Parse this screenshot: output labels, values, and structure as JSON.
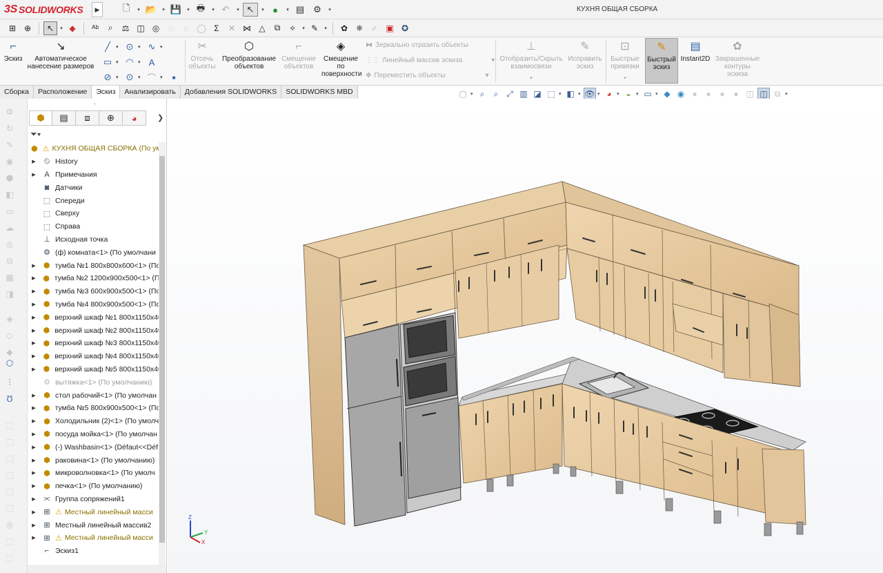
{
  "app": {
    "logo_text": "SOLIDWORKS",
    "logo_prefix": "3S",
    "document_title": "КУХНЯ ОБЩАЯ СБОРКА"
  },
  "quick_access": [
    "new-icon",
    "open-icon",
    "save-icon",
    "print-icon",
    "undo-icon",
    "select-icon",
    "rebuild-icon",
    "file-properties-icon",
    "options-icon"
  ],
  "ribbon": {
    "sketch": "Эскиз",
    "smart_dimension": "Автоматическое нанесение размеров",
    "trim": "Отсечь объекты",
    "convert": "Преобразование объектов",
    "offset": "Смещение объектов",
    "offset_surface": "Смещение по поверхности",
    "mirror": "Зеркально отразить объекты",
    "linear_pattern": "Линейный массив эскиза",
    "move": "Переместить объекты",
    "display_relations": "Отобразить/Скрыть взаимосвязи",
    "repair": "Исправить эскиз",
    "quick_snaps": "Быстрые привязки",
    "rapid_sketch": "Быстрый эскиз",
    "instant2d": "Instant2D",
    "shaded_contours": "Закрашенные контуры эскиза"
  },
  "tabs": [
    "Сборка",
    "Расположение",
    "Эскиз",
    "Анализировать",
    "Добавления SOLIDWORKS",
    "SOLIDWORKS MBD"
  ],
  "active_tab": "Эскиз",
  "tree": {
    "root": "КУХНЯ ОБЩАЯ СБОРКА  (По ум",
    "items": [
      {
        "label": "History",
        "icon": "history-folder-icon",
        "exp": true
      },
      {
        "label": "Примечания",
        "icon": "annotations-icon",
        "exp": true
      },
      {
        "label": "Датчики",
        "icon": "sensors-icon",
        "exp": false
      },
      {
        "label": "Спереди",
        "icon": "plane-icon",
        "exp": false
      },
      {
        "label": "Сверху",
        "icon": "plane-icon",
        "exp": false
      },
      {
        "label": "Справа",
        "icon": "plane-icon",
        "exp": false
      },
      {
        "label": "Исходная точка",
        "icon": "origin-icon",
        "exp": false
      },
      {
        "label": "(ф) комната<1> (По умолчани",
        "icon": "part-icon",
        "exp": false
      },
      {
        "label": "тумба №1  800х800х600<1> (По",
        "icon": "assembly-icon",
        "exp": true
      },
      {
        "label": "тумба №2 1200х900х500<1> (По",
        "icon": "assembly-icon",
        "exp": true
      },
      {
        "label": "тумба №3 600х900х500<1> (По",
        "icon": "assembly-icon",
        "exp": true
      },
      {
        "label": "тумба №4 800х900х500<1> (По",
        "icon": "assembly-icon",
        "exp": true
      },
      {
        "label": "верхний шкаф №1 800х1150х40",
        "icon": "assembly-icon",
        "exp": true
      },
      {
        "label": "верхний шкаф №2 800х1150х40",
        "icon": "assembly-icon",
        "exp": true
      },
      {
        "label": "верхний шкаф №3 800х1150х40",
        "icon": "assembly-icon",
        "exp": true
      },
      {
        "label": "верхний шкаф №4 800х1150х40",
        "icon": "assembly-icon",
        "exp": true
      },
      {
        "label": "верхний шкаф №5 800х1150х40",
        "icon": "assembly-icon",
        "exp": true
      },
      {
        "label": "вытяжка<1> (По умолчанию)",
        "icon": "suppressed-icon",
        "exp": false,
        "gray": true
      },
      {
        "label": "стол рабочий<1> (По умолчан",
        "icon": "assembly-icon",
        "exp": true
      },
      {
        "label": "тумба №5 800х900х500<1> (По",
        "icon": "assembly-icon",
        "exp": true
      },
      {
        "label": "Холодильник (2)<1> (По умолч",
        "icon": "assembly-icon",
        "exp": true
      },
      {
        "label": "посуда мойка<1> (По умолчан",
        "icon": "assembly-icon",
        "exp": true
      },
      {
        "label": "(-) Washbasin<1> (Défaut<<Déf",
        "icon": "assembly-icon",
        "exp": true
      },
      {
        "label": "раковина<1> (По умолчанию)",
        "icon": "assembly-icon",
        "exp": true
      },
      {
        "label": "микроволновка<1> (По умолч",
        "icon": "assembly-icon",
        "exp": true
      },
      {
        "label": "печка<1> (По умолчанию)",
        "icon": "assembly-icon",
        "exp": true
      },
      {
        "label": "Группа сопряжений1",
        "icon": "mates-icon",
        "exp": true
      },
      {
        "label": "Местный линейный масси",
        "icon": "pattern-icon",
        "exp": true,
        "warn": true
      },
      {
        "label": "Местный линейный массив2",
        "icon": "pattern-icon",
        "exp": true
      },
      {
        "label": "Местный линейный масси",
        "icon": "pattern-icon",
        "exp": true,
        "warn": true
      },
      {
        "label": "Эскиз1",
        "icon": "sketch-icon",
        "exp": false
      }
    ]
  },
  "triad": {
    "x": "X",
    "y": "Y",
    "z": "Z"
  }
}
